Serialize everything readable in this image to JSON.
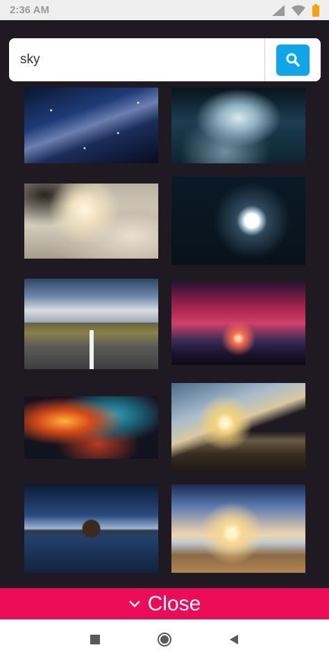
{
  "status_bar": {
    "time": "2:36 AM"
  },
  "search": {
    "value": "sky"
  },
  "results": {
    "thumbnails": [
      {
        "icon": "milky-way-image"
      },
      {
        "icon": "stormy-clouds-image"
      },
      {
        "icon": "woman-in-clouds-image"
      },
      {
        "icon": "full-moon-image"
      },
      {
        "icon": "road-under-sky-image"
      },
      {
        "icon": "tree-at-sunset-image"
      },
      {
        "icon": "colorful-nebula-image"
      },
      {
        "icon": "sunset-over-mountains-image"
      },
      {
        "icon": "tree-reflection-image"
      },
      {
        "icon": "beach-sunrise-image"
      }
    ]
  },
  "close_bar": {
    "label": "Close"
  },
  "colors": {
    "accent": "#ec0b56",
    "search_button": "#0ea5e9",
    "background": "#1f1a22"
  }
}
